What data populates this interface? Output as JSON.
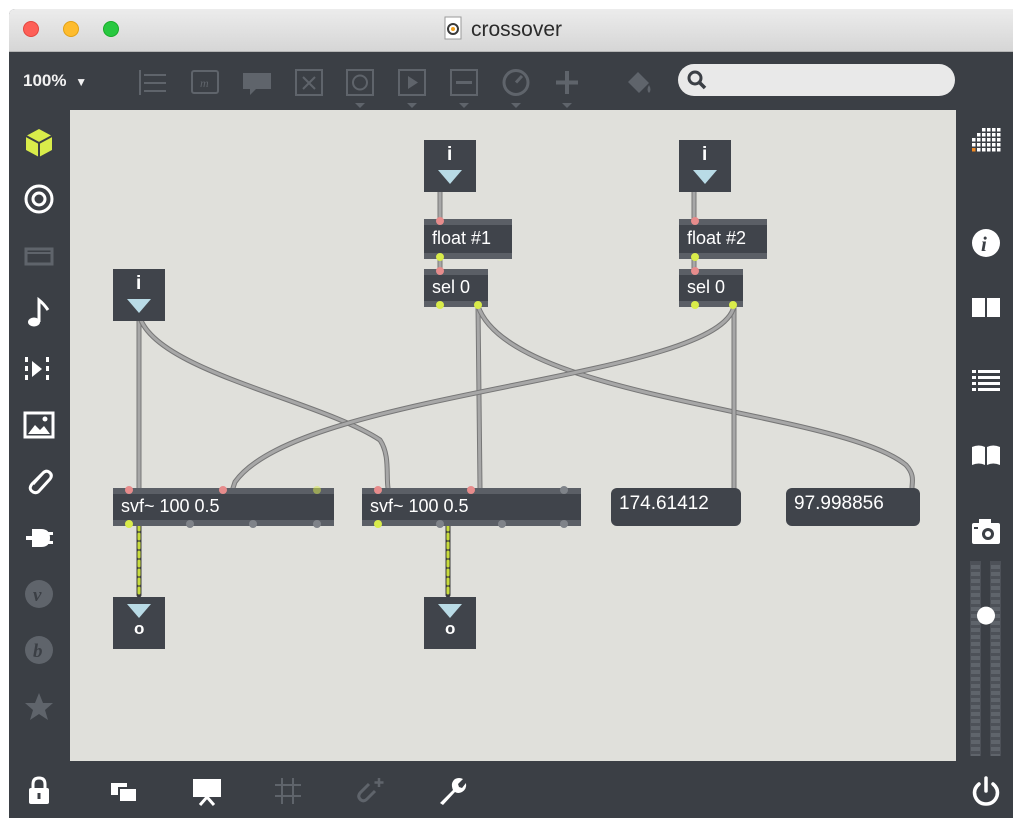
{
  "window": {
    "title": "crossover",
    "traffic_lights": {
      "close": "#fe5f57",
      "minimize": "#febc2e",
      "zoom": "#28c840"
    }
  },
  "toolbar": {
    "zoom_label": "100%",
    "zoom_arrow": "▼",
    "search": {
      "value": "",
      "placeholder": ""
    },
    "icons": [
      "bpatcher-icon",
      "message-icon",
      "comment-icon",
      "toggle-icon",
      "button-icon",
      "play-icon",
      "slider-icon",
      "dial-icon",
      "add-icon",
      "paint-bucket-icon"
    ]
  },
  "left_sidebar": {
    "icons": [
      "cube-icon",
      "target-icon",
      "device-icon",
      "music-note-icon",
      "sequencer-icon",
      "image-icon",
      "paperclip-icon",
      "plug-icon",
      "v-icon",
      "b-icon",
      "star-icon"
    ]
  },
  "right_sidebar": {
    "icons": [
      "grid-icon",
      "info-icon",
      "book-split-icon",
      "list-icon",
      "book-icon",
      "camera-icon",
      "level-meter-icon"
    ],
    "volume_level": 0.72
  },
  "bottom_bar": {
    "icons": [
      "lock-icon",
      "windows-icon",
      "presentation-icon",
      "grid-icon",
      "add-clip-icon",
      "wrench-icon",
      "power-icon"
    ]
  },
  "patch": {
    "inlets": [
      {
        "label": "i"
      },
      {
        "label": "i"
      },
      {
        "label": "i"
      }
    ],
    "outlets": [
      {
        "label": "o"
      },
      {
        "label": "o"
      }
    ],
    "objects": {
      "float1": "float #1",
      "float2": "float #2",
      "sel1": "sel 0",
      "sel2": "sel 0",
      "svf1": "svf~ 100 0.5",
      "svf2": "svf~ 100 0.5"
    },
    "number_boxes": [
      "174.61412",
      "97.998856"
    ]
  },
  "colors": {
    "canvas": "#e0e0db",
    "ui_dark": "#3b3f45",
    "object_fill": "#40444b",
    "patch_cord": "#9a9a9a",
    "signal_cord": "#c8dc3c",
    "accent_yellow": "#d9ec4a",
    "arrow_cyan": "#b9dbe6"
  }
}
